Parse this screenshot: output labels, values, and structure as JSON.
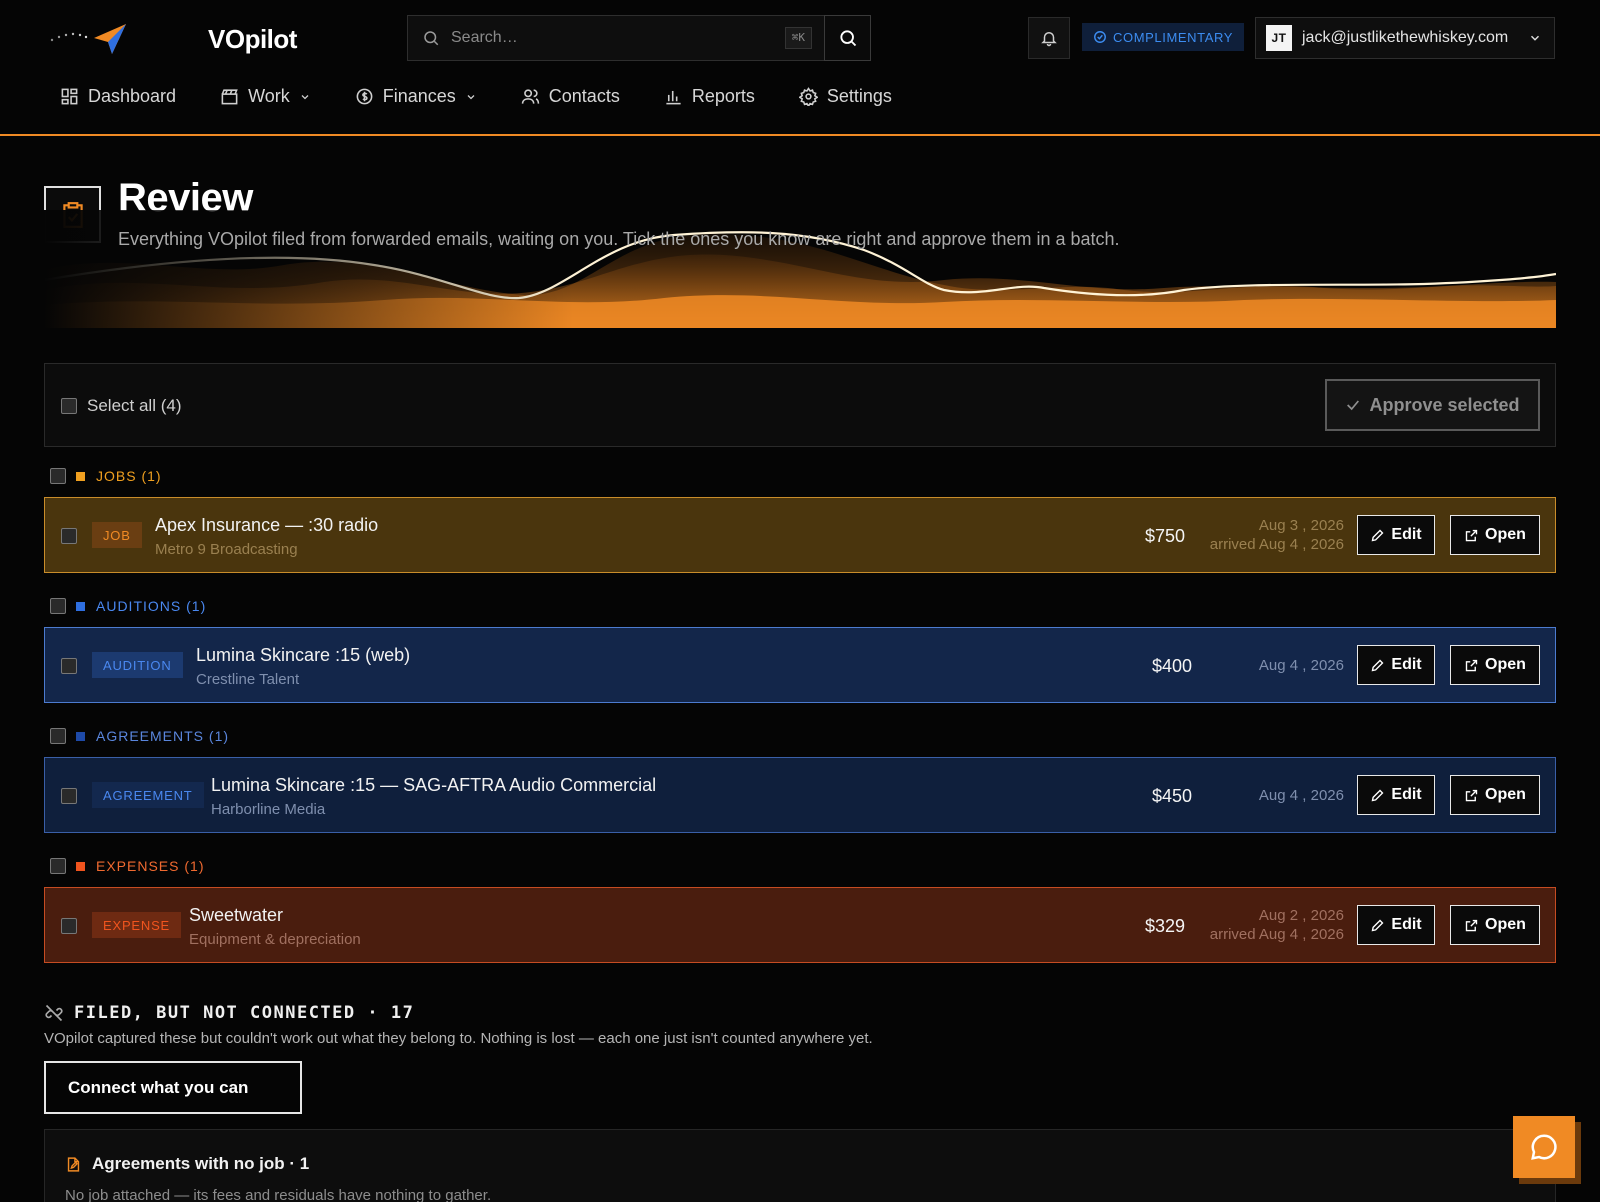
{
  "app": {
    "name": "VOpilot"
  },
  "search": {
    "placeholder": "Search…",
    "shortcut": "⌘K"
  },
  "header": {
    "plan_badge": "COMPLIMENTARY",
    "user": {
      "initials": "JT",
      "email": "jack@justlikethewhiskey.com"
    }
  },
  "nav": [
    {
      "label": "Dashboard",
      "icon": "dashboard-icon",
      "has_dropdown": false
    },
    {
      "label": "Work",
      "icon": "clapperboard-icon",
      "has_dropdown": true
    },
    {
      "label": "Finances",
      "icon": "dollar-circle-icon",
      "has_dropdown": true
    },
    {
      "label": "Contacts",
      "icon": "users-icon",
      "has_dropdown": false
    },
    {
      "label": "Reports",
      "icon": "bar-chart-icon",
      "has_dropdown": false
    },
    {
      "label": "Settings",
      "icon": "gear-icon",
      "has_dropdown": false
    }
  ],
  "page": {
    "title": "Review",
    "subtitle": "Everything VOpilot filed from forwarded emails, waiting on you. Tick the ones you know are right and approve them in a batch."
  },
  "toolbar": {
    "select_all_label": "Select all (4)",
    "approve_label": "Approve selected"
  },
  "groups": [
    {
      "heading": "JOBS (1)",
      "color": "#f0a020",
      "item": {
        "tag": "JOB",
        "title": "Apex Insurance — :30 radio",
        "subtitle": "Metro 9 Broadcasting",
        "amount": "$750",
        "date": "Aug 3 , 2026",
        "arrived": "arrived Aug 4 , 2026",
        "edit_label": "Edit",
        "open_label": "Open"
      }
    },
    {
      "heading": "AUDITIONS (1)",
      "color": "#4a88f0",
      "item": {
        "tag": "AUDITION",
        "title": "Lumina Skincare :15 (web)",
        "subtitle": "Crestline Talent",
        "amount": "$400",
        "date": "Aug 4 , 2026",
        "edit_label": "Edit",
        "open_label": "Open"
      }
    },
    {
      "heading": "AGREEMENTS (1)",
      "color": "#3a6ad0",
      "item": {
        "tag": "AGREEMENT",
        "title": "Lumina Skincare :15 — SAG-AFTRA Audio Commercial",
        "subtitle": "Harborline Media",
        "amount": "$450",
        "date": "Aug 4 , 2026",
        "edit_label": "Edit",
        "open_label": "Open"
      }
    },
    {
      "heading": "EXPENSES (1)",
      "color": "#f06a30",
      "item": {
        "tag": "EXPENSE",
        "title": "Sweetwater",
        "subtitle": "Equipment & depreciation",
        "amount": "$329",
        "date": "Aug 2 , 2026",
        "arrived": "arrived Aug 4 , 2026",
        "edit_label": "Edit",
        "open_label": "Open"
      }
    }
  ],
  "filed": {
    "title": "FILED, BUT NOT CONNECTED · 17",
    "description": "VOpilot captured these but couldn't work out what they belong to. Nothing is lost — each one just isn't counted anywhere yet.",
    "connect_label": "Connect what you can",
    "panel": {
      "title": "Agreements with no job · 1",
      "subtitle": "No job attached — its fees and residuals have nothing to gather."
    }
  },
  "colors": {
    "accent": "#f08a24",
    "job": "#c98d2a",
    "audition": "#4c7bd0",
    "agreement": "#3a5fa8",
    "expense": "#c64c22"
  }
}
